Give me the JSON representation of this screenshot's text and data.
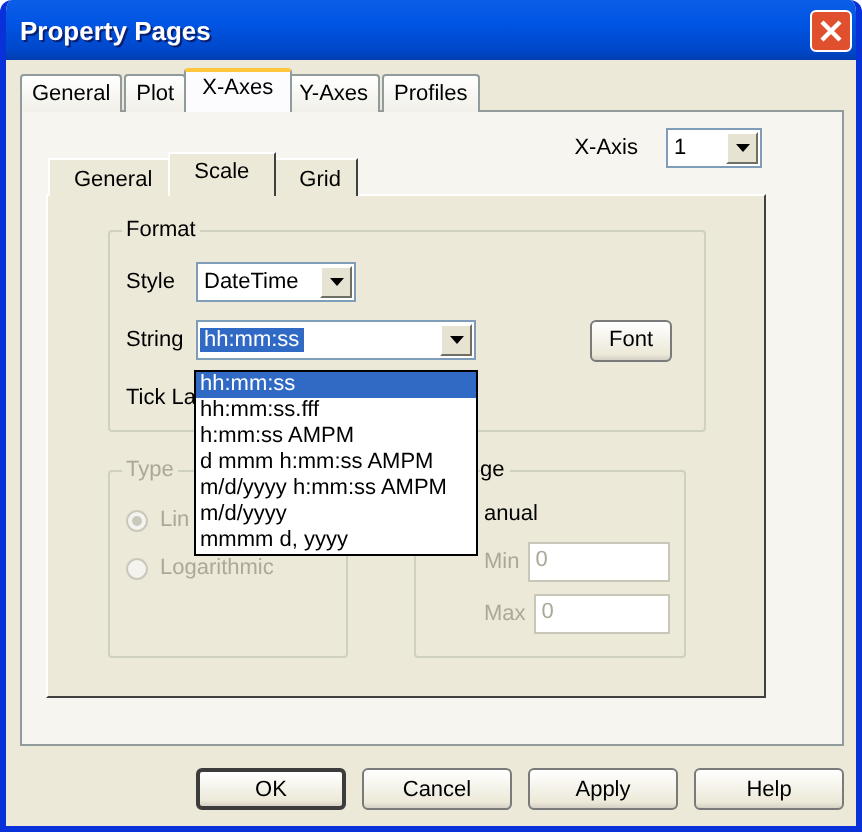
{
  "window": {
    "title": "Property Pages"
  },
  "tabs": [
    {
      "label": "General",
      "selected": false
    },
    {
      "label": "Plot",
      "selected": false
    },
    {
      "label": "X-Axes",
      "selected": true
    },
    {
      "label": "Y-Axes",
      "selected": false
    },
    {
      "label": "Profiles",
      "selected": false
    }
  ],
  "axis_selector": {
    "label": "X-Axis",
    "value": "1"
  },
  "sub_tabs": [
    {
      "label": "General",
      "selected": false
    },
    {
      "label": "Scale",
      "selected": true
    },
    {
      "label": "Grid",
      "selected": false
    }
  ],
  "format": {
    "title": "Format",
    "style": {
      "label": "Style",
      "value": "DateTime"
    },
    "string": {
      "label": "String",
      "value": "hh:mm:ss",
      "text_selected": true
    },
    "font_button": "Font",
    "tick_label": "Tick La"
  },
  "string_dropdown": {
    "options": [
      {
        "label": "hh:mm:ss",
        "selected": true
      },
      {
        "label": "hh:mm:ss.fff",
        "selected": false
      },
      {
        "label": "h:mm:ss AMPM",
        "selected": false
      },
      {
        "label": "d mmm h:mm:ss AMPM",
        "selected": false
      },
      {
        "label": "m/d/yyyy h:mm:ss AMPM",
        "selected": false
      },
      {
        "label": "m/d/yyyy",
        "selected": false
      },
      {
        "label": "mmmm d, yyyy",
        "selected": false
      }
    ]
  },
  "type": {
    "title": "Type",
    "disabled": true,
    "options": [
      {
        "label": "Lin",
        "selected": true
      },
      {
        "label": "Logarithmic",
        "selected": false
      }
    ]
  },
  "range": {
    "title": "ge",
    "manual_label": "anual",
    "fields": [
      {
        "label": "Min",
        "value": "0",
        "disabled": true
      },
      {
        "label": "Max",
        "value": "0",
        "disabled": true
      }
    ]
  },
  "buttons": [
    {
      "label": "OK",
      "default": true
    },
    {
      "label": "Cancel",
      "default": false
    },
    {
      "label": "Apply",
      "default": false
    },
    {
      "label": "Help",
      "default": false
    }
  ]
}
